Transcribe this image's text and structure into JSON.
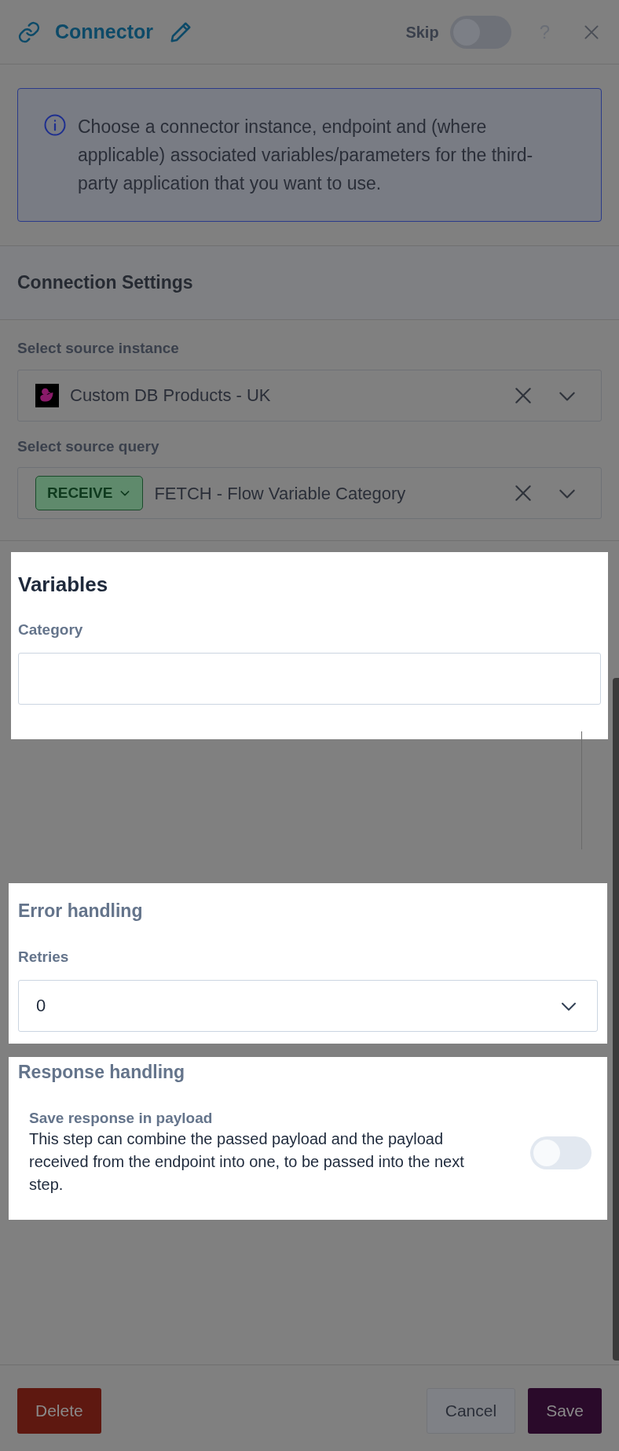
{
  "header": {
    "title": "Connector",
    "skip": {
      "label": "Skip",
      "on": false
    },
    "help": "?"
  },
  "info": "Choose a connector instance, endpoint and (where applicable) associated variables/parameters for the third-party application that you want to use.",
  "connection_settings": {
    "title": "Connection Settings",
    "highlighted": false,
    "fields": [
      {
        "kind": "instance",
        "label": "Select source instance",
        "value": "Custom DB Products - UK"
      },
      {
        "kind": "query",
        "label": "Select source query",
        "badge": "RECEIVE",
        "value": "FETCH - Flow Variable Category"
      }
    ]
  },
  "variables": {
    "title": "Variables",
    "highlighted": true,
    "fields": [
      {
        "label": "Category"
      }
    ]
  },
  "error_handling": {
    "title": "Error handling",
    "highlighted": true,
    "retries": {
      "label": "Retries",
      "value": "0"
    }
  },
  "response_handling": {
    "title": "Response handling",
    "highlighted": true,
    "option": {
      "label": "Save response in payload",
      "description": "This step can combine the passed payload and the payload received from the endpoint into one, to be passed into the next step.",
      "on": false
    }
  },
  "footer": {
    "buttons": [
      {
        "kind": "danger",
        "label": "Delete"
      },
      {
        "kind": "secondary",
        "label": "Cancel"
      },
      {
        "kind": "primary",
        "label": "Save"
      }
    ]
  }
}
